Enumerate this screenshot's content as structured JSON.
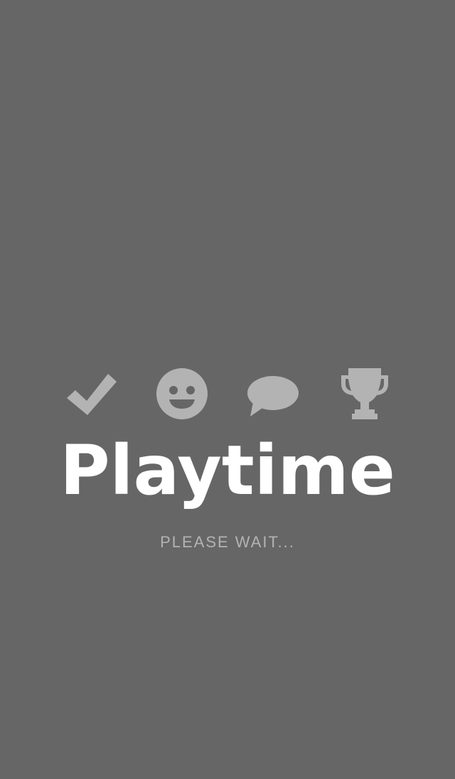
{
  "app": {
    "title": "Playtime",
    "status": "PLEASE WAIT..."
  },
  "icons": [
    "checkmark-icon",
    "smiley-face-icon",
    "chat-bubble-icon",
    "trophy-icon"
  ],
  "colors": {
    "background": "#666666",
    "title": "#ffffff",
    "icon": "#b3b3b3",
    "status": "#b3b3b3"
  }
}
